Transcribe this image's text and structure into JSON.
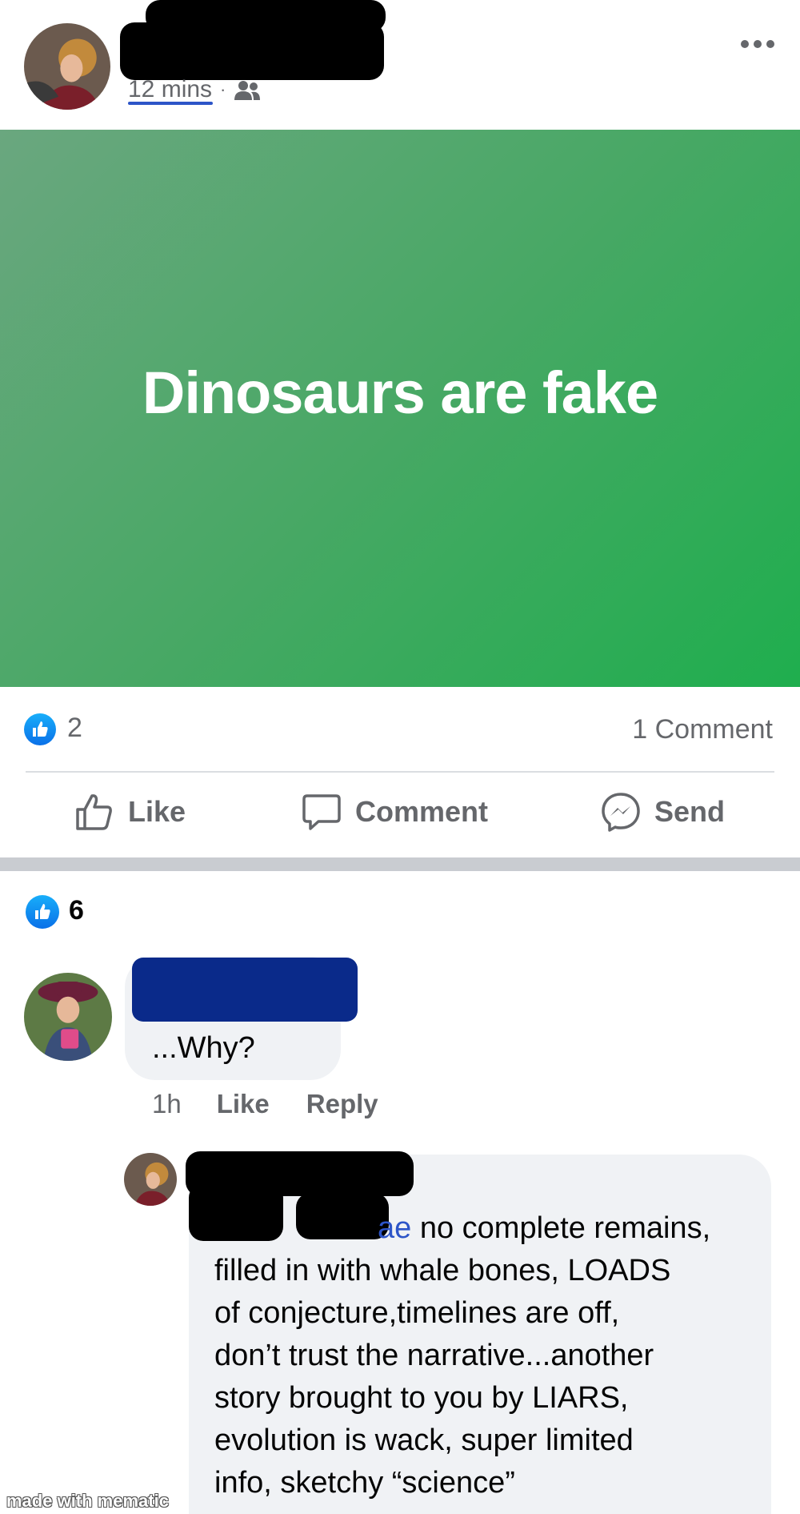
{
  "post": {
    "time": "12 mins",
    "status_text": "Dinosaurs are fake",
    "colors": {
      "card_start": "#6aa77f",
      "card_end": "#1fae4e",
      "like_blue": "#0a70e8"
    }
  },
  "reactions": {
    "like_count": "2",
    "comment_count": "1 Comment"
  },
  "actions": {
    "like": "Like",
    "comment": "Comment",
    "send": "Send"
  },
  "comment_section": {
    "like_count": "6"
  },
  "comments": [
    {
      "text": "...Why?",
      "time": "1h",
      "like_label": "Like",
      "reply_label": "Reply"
    }
  ],
  "reply": {
    "mention_partial": "ae",
    "lines": [
      " no complete remains,",
      "filled in with whale bones, LOADS",
      "of conjecture,timelines are off,",
      "don’t trust the narrative...another",
      "story brought to you by LIARS,",
      "evolution is wack, super limited",
      "info, sketchy “science”"
    ]
  },
  "watermark": "made with mematic"
}
